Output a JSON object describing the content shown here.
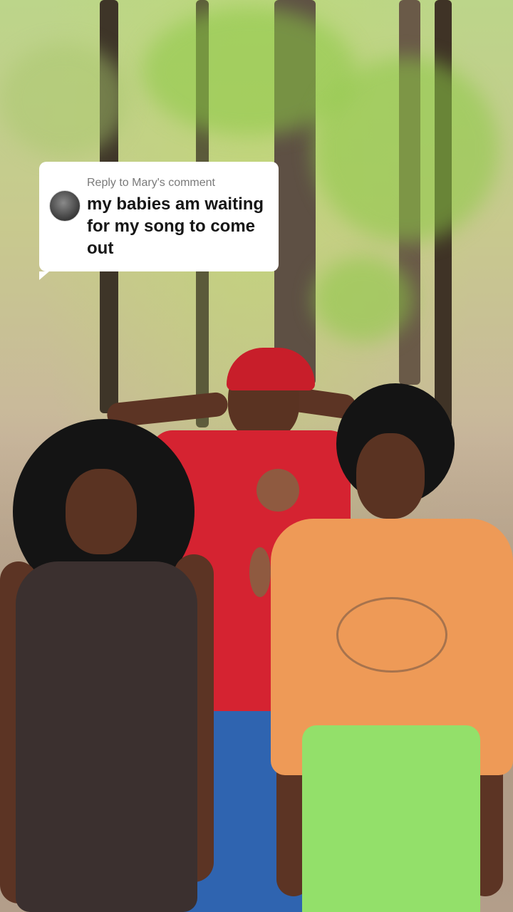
{
  "reply_bubble": {
    "reply_to": "Reply to Mary's comment",
    "comment": "my babies am waiting for my song to come out"
  },
  "colors": {
    "bubble_bg": "#ffffff",
    "comment_text": "#161616",
    "reply_text": "#7a7a7a"
  },
  "icons": {
    "avatar": "commenter-avatar"
  }
}
